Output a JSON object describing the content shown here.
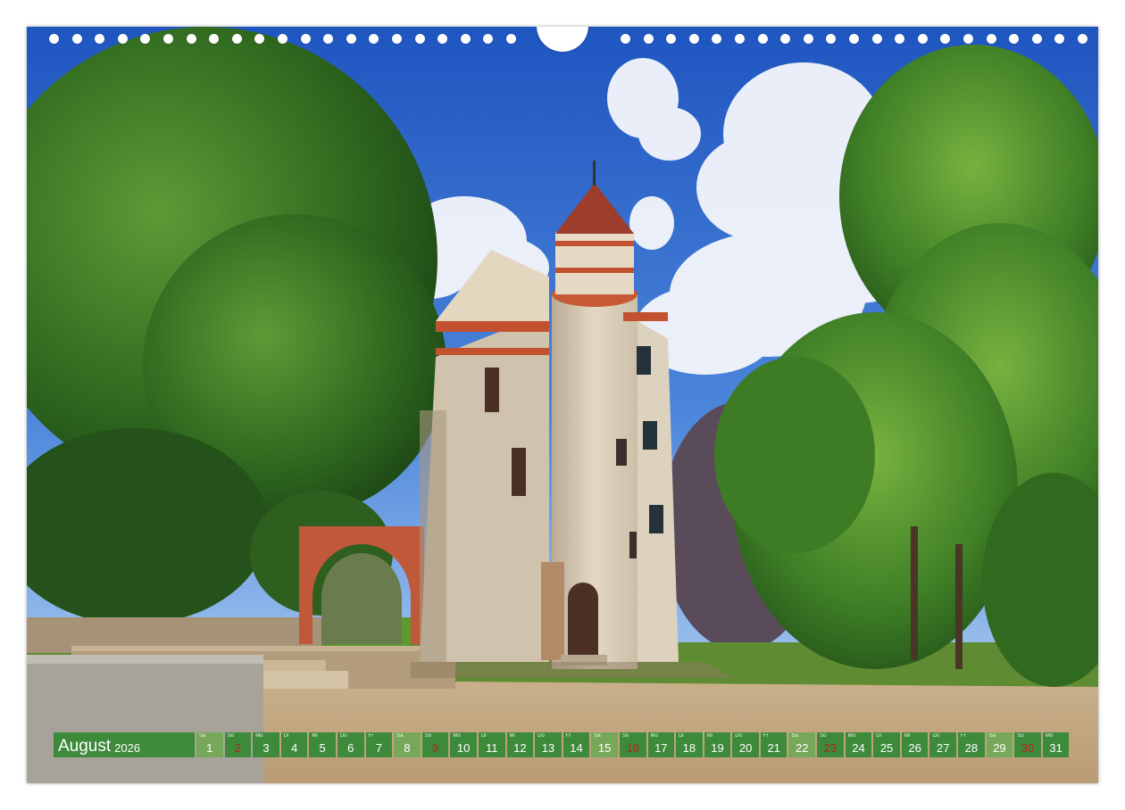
{
  "calendar": {
    "month": "August",
    "year": "2026",
    "days": [
      {
        "wd": "Sa",
        "num": "1",
        "type": "sat"
      },
      {
        "wd": "So",
        "num": "2",
        "type": "sun"
      },
      {
        "wd": "Mo",
        "num": "3",
        "type": "week"
      },
      {
        "wd": "Di",
        "num": "4",
        "type": "week"
      },
      {
        "wd": "Mi",
        "num": "5",
        "type": "week"
      },
      {
        "wd": "Do",
        "num": "6",
        "type": "week"
      },
      {
        "wd": "Fr",
        "num": "7",
        "type": "week"
      },
      {
        "wd": "Sa",
        "num": "8",
        "type": "sat"
      },
      {
        "wd": "So",
        "num": "9",
        "type": "sun"
      },
      {
        "wd": "Mo",
        "num": "10",
        "type": "week"
      },
      {
        "wd": "Di",
        "num": "11",
        "type": "week"
      },
      {
        "wd": "Mi",
        "num": "12",
        "type": "week"
      },
      {
        "wd": "Do",
        "num": "13",
        "type": "week"
      },
      {
        "wd": "Fr",
        "num": "14",
        "type": "week"
      },
      {
        "wd": "Sa",
        "num": "15",
        "type": "sat"
      },
      {
        "wd": "So",
        "num": "16",
        "type": "sun"
      },
      {
        "wd": "Mo",
        "num": "17",
        "type": "week"
      },
      {
        "wd": "Di",
        "num": "18",
        "type": "week"
      },
      {
        "wd": "Mi",
        "num": "19",
        "type": "week"
      },
      {
        "wd": "Do",
        "num": "20",
        "type": "week"
      },
      {
        "wd": "Fr",
        "num": "21",
        "type": "week"
      },
      {
        "wd": "Sa",
        "num": "22",
        "type": "sat"
      },
      {
        "wd": "So",
        "num": "23",
        "type": "sun"
      },
      {
        "wd": "Mo",
        "num": "24",
        "type": "week"
      },
      {
        "wd": "Di",
        "num": "25",
        "type": "week"
      },
      {
        "wd": "Mi",
        "num": "26",
        "type": "week"
      },
      {
        "wd": "Do",
        "num": "27",
        "type": "week"
      },
      {
        "wd": "Fr",
        "num": "28",
        "type": "week"
      },
      {
        "wd": "Sa",
        "num": "29",
        "type": "sat"
      },
      {
        "wd": "So",
        "num": "30",
        "type": "sun"
      },
      {
        "wd": "Mo",
        "num": "31",
        "type": "week"
      }
    ]
  },
  "colors": {
    "calendar_green": "#3e8a3b",
    "saturday_green": "#77a85a",
    "sunday_red": "#b8251c",
    "sky_blue": "#2f66c8"
  },
  "icons": [
    "binding-hole-icon",
    "hanger-cutout-icon"
  ]
}
